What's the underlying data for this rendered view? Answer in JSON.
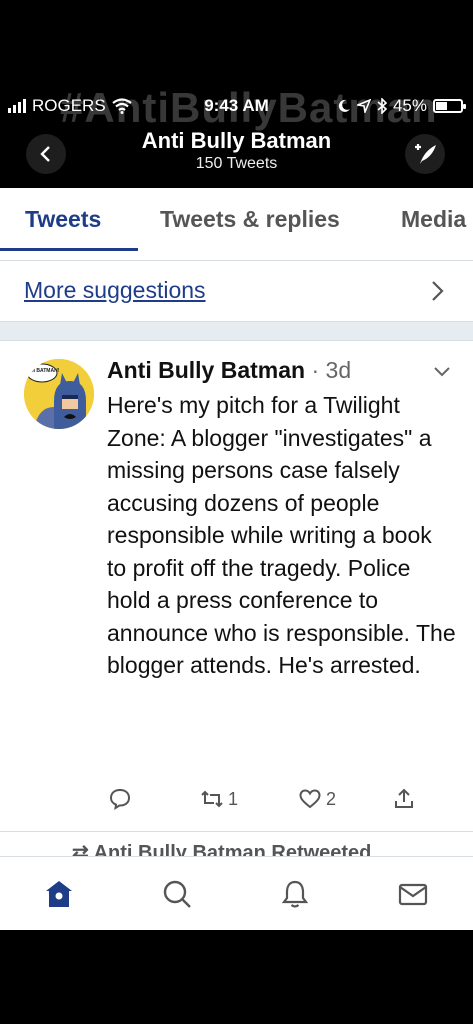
{
  "status_bar": {
    "carrier": "ROGERS",
    "time": "9:43 AM",
    "battery": "45%",
    "battery_level": 0.45
  },
  "watermark": "#AntiBullyBatman",
  "header": {
    "title": "Anti Bully Batman",
    "subtitle": "150 Tweets"
  },
  "tabs": [
    {
      "label": "Tweets",
      "active": true
    },
    {
      "label": "Tweets & replies",
      "active": false
    },
    {
      "label": "Media",
      "active": false
    }
  ],
  "suggestions": {
    "label": "More suggestions"
  },
  "tweet": {
    "avatar_caption": "I AM BATMAN!",
    "name": "Anti Bully Batman",
    "separator": "·",
    "time": "3d",
    "text": "Here's my pitch for a Twilight Zone: A blogger \"investigates\" a missing persons case falsely accusing dozens of people responsible while writing a book to profit off the tragedy. Police hold a press conference to announce who is responsible. The blogger attends. He's arrested.",
    "retweets": "1",
    "likes": "2"
  },
  "next_item": {
    "label": "Anti Bully Batman Retweeted"
  },
  "colors": {
    "accent": "#1f3c88",
    "background_dark": "#000000",
    "separator": "#e6ecf0"
  },
  "icons": {
    "home": "home-icon",
    "search": "search-icon",
    "notifications": "bell-icon",
    "messages": "envelope-icon"
  }
}
